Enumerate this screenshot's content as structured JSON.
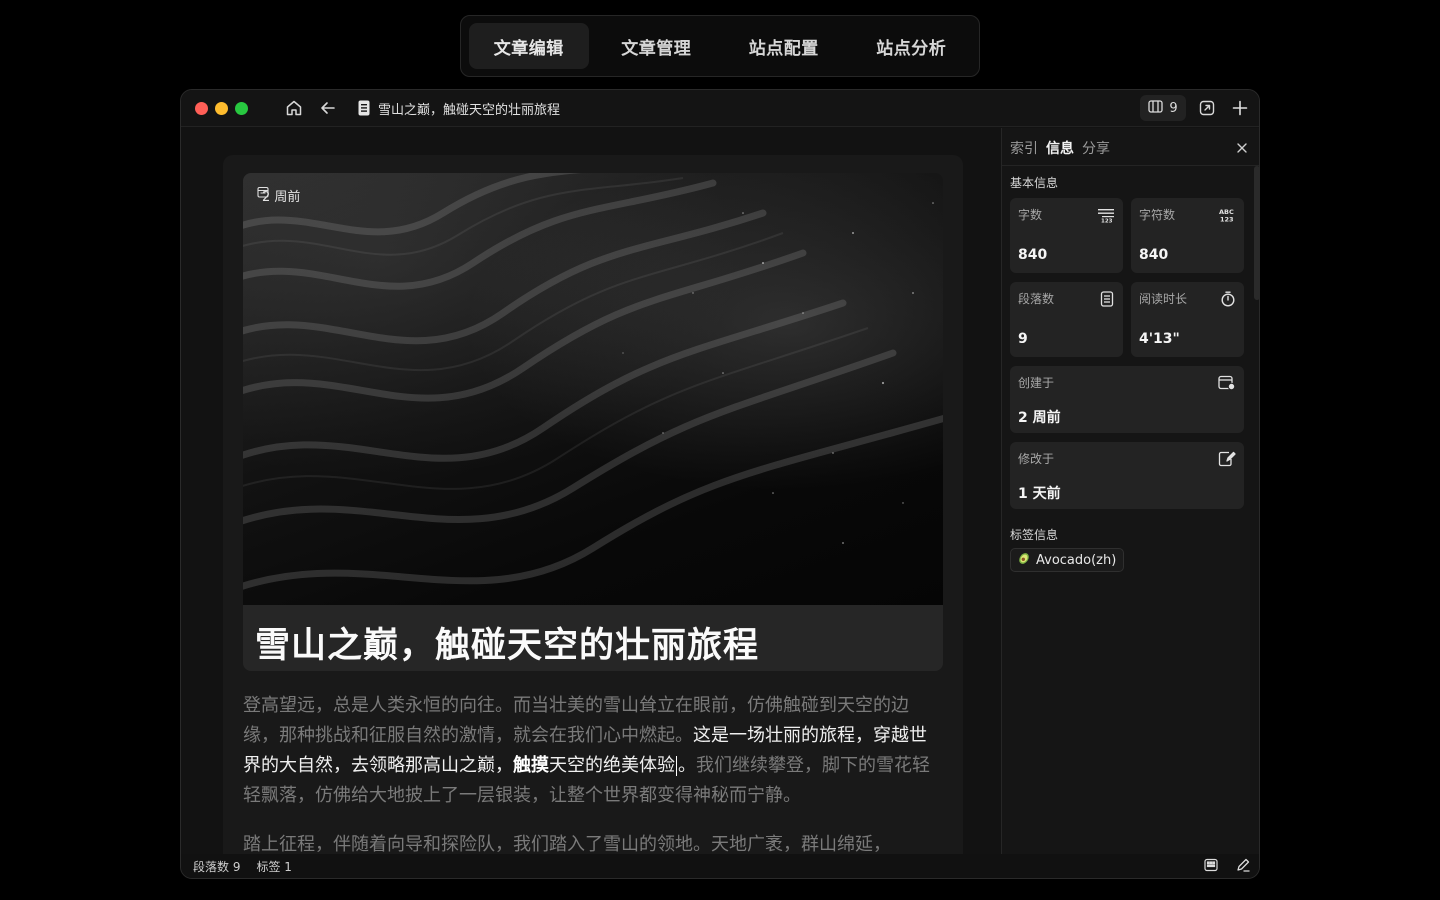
{
  "top_nav": {
    "tabs": [
      "文章编辑",
      "文章管理",
      "站点配置",
      "站点分析"
    ],
    "active_index": 0
  },
  "titlebar": {
    "document_title": "雪山之巅，触碰天空的壮丽旅程",
    "panel_count": "9"
  },
  "editor": {
    "cover_date": "2 周前",
    "article_title": "雪山之巅，触碰天空的壮丽旅程",
    "paragraph1_part1": "登高望远，总是人类永恒的向往。而当壮美的雪山耸立在眼前，仿佛触碰到天空的边缘，那种挑战和征服自然的激情，就会在我们心中燃起。",
    "paragraph1_highlight1": "这是一场壮丽的旅程，穿越世界的大自然，去领略那高山之巅，",
    "paragraph1_bold": "触摸",
    "paragraph1_highlight2": "天空的绝美体验",
    "paragraph1_highlight3": "。",
    "paragraph1_part2": "我们继续攀登，脚下的雪花轻轻飘落，仿佛给大地披上了一层银装，让整个世界都变得神秘而宁静。",
    "paragraph2": "踏上征程，伴随着向导和探险队，我们踏入了雪山的领地。天地广袤，群山绵延，"
  },
  "statusbar": {
    "paragraph_count": "段落数 9",
    "tag_count": "标签 1"
  },
  "sidepanel": {
    "tabs": [
      "索引",
      "信息",
      "分享"
    ],
    "active_tab": "信息",
    "basic_info_label": "基本信息",
    "word_count_label": "字数",
    "word_count": "840",
    "char_count_label": "字符数",
    "char_count": "840",
    "paragraph_label": "段落数",
    "paragraph_value": "9",
    "read_time_label": "阅读时长",
    "read_time": "4'13\"",
    "created_label": "创建于",
    "created_value": "2 周前",
    "modified_label": "修改于",
    "modified_value": "1 天前",
    "tags_label": "标签信息",
    "tag_name": "Avocado(zh)",
    "abc_icon_text": "ABC",
    "num_icon_text": "123"
  },
  "colors": {
    "background": "#000000",
    "window": "#121212",
    "card": "#232323",
    "close_red": "#ff5f57",
    "minimize_yellow": "#febc2e",
    "zoom_green": "#28c840"
  }
}
